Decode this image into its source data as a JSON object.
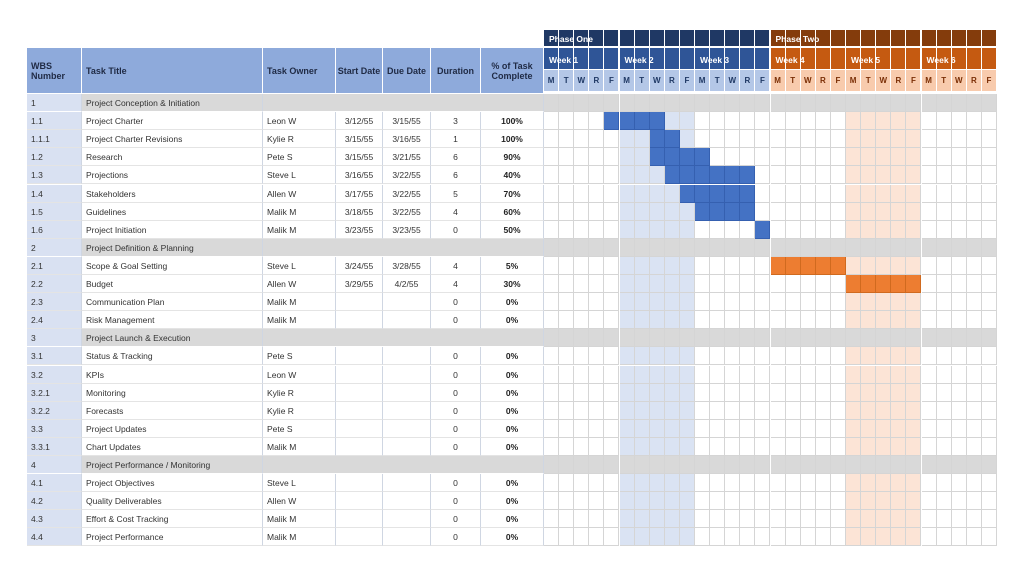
{
  "header": {
    "wbs": "WBS Number",
    "task_title": "Task Title",
    "task_owner": "Task Owner",
    "start_date": "Start Date",
    "due_date": "Due Date",
    "duration": "Duration",
    "pct_complete": "% of Task Complete"
  },
  "phases": [
    {
      "label": "Phase One",
      "weeks": 3
    },
    {
      "label": "Phase Two",
      "weeks": 3
    }
  ],
  "weeks": [
    "Week 1",
    "Week 2",
    "Week 3",
    "Week 4",
    "Week 5",
    "Week 6"
  ],
  "day_letters": [
    "M",
    "T",
    "W",
    "R",
    "F"
  ],
  "colors": {
    "phase_one_dark": "#1f3864",
    "phase_one_header": "#2f5597",
    "phase_one_day": "#b4c7e7",
    "phase_one_bar": "#4472c4",
    "phase_two_dark": "#843c0c",
    "phase_two_header": "#c55a11",
    "phase_two_day": "#f8cbad",
    "phase_two_bar": "#ed7d31",
    "highlight_blue": "#dae3f3",
    "highlight_orange": "#fce4d6"
  },
  "rows": [
    {
      "type": "section",
      "wbs": "1",
      "title": "Project Conception & Initiation"
    },
    {
      "type": "task",
      "wbs": "1.1",
      "title": "Project Charter",
      "owner": "Leon W",
      "start": "3/12/55",
      "due": "3/15/55",
      "duration": "3",
      "pct": "100%",
      "bar_start": 4,
      "bar_len": 4
    },
    {
      "type": "task",
      "wbs": "1.1.1",
      "title": "Project Charter Revisions",
      "owner": "Kylie R",
      "start": "3/15/55",
      "due": "3/16/55",
      "duration": "1",
      "pct": "100%",
      "bar_start": 7,
      "bar_len": 2
    },
    {
      "type": "task",
      "wbs": "1.2",
      "title": "Research",
      "owner": "Pete S",
      "start": "3/15/55",
      "due": "3/21/55",
      "duration": "6",
      "pct": "90%",
      "bar_start": 7,
      "bar_len": 4
    },
    {
      "type": "task",
      "wbs": "1.3",
      "title": "Projections",
      "owner": "Steve L",
      "start": "3/16/55",
      "due": "3/22/55",
      "duration": "6",
      "pct": "40%",
      "bar_start": 8,
      "bar_len": 6
    },
    {
      "type": "task",
      "wbs": "1.4",
      "title": "Stakeholders",
      "owner": "Allen W",
      "start": "3/17/55",
      "due": "3/22/55",
      "duration": "5",
      "pct": "70%",
      "bar_start": 9,
      "bar_len": 5
    },
    {
      "type": "task",
      "wbs": "1.5",
      "title": "Guidelines",
      "owner": "Malik M",
      "start": "3/18/55",
      "due": "3/22/55",
      "duration": "4",
      "pct": "60%",
      "bar_start": 10,
      "bar_len": 4
    },
    {
      "type": "task",
      "wbs": "1.6",
      "title": "Project Initiation",
      "owner": "Malik M",
      "start": "3/23/55",
      "due": "3/23/55",
      "duration": "0",
      "pct": "50%",
      "bar_start": 14,
      "bar_len": 1
    },
    {
      "type": "section",
      "wbs": "2",
      "title": "Project Definition & Planning"
    },
    {
      "type": "task",
      "wbs": "2.1",
      "title": "Scope & Goal Setting",
      "owner": "Steve L",
      "start": "3/24/55",
      "due": "3/28/55",
      "duration": "4",
      "pct": "5%",
      "bar_start": 15,
      "bar_len": 5
    },
    {
      "type": "task",
      "wbs": "2.2",
      "title": "Budget",
      "owner": "Allen W",
      "start": "3/29/55",
      "due": "4/2/55",
      "duration": "4",
      "pct": "30%",
      "bar_start": 20,
      "bar_len": 5
    },
    {
      "type": "task",
      "wbs": "2.3",
      "title": "Communication Plan",
      "owner": "Malik M",
      "start": "",
      "due": "",
      "duration": "0",
      "pct": "0%"
    },
    {
      "type": "task",
      "wbs": "2.4",
      "title": "Risk Management",
      "owner": "Malik M",
      "start": "",
      "due": "",
      "duration": "0",
      "pct": "0%"
    },
    {
      "type": "section",
      "wbs": "3",
      "title": "Project Launch & Execution"
    },
    {
      "type": "task",
      "wbs": "3.1",
      "title": "Status & Tracking",
      "owner": "Pete S",
      "start": "",
      "due": "",
      "duration": "0",
      "pct": "0%"
    },
    {
      "type": "task",
      "wbs": "3.2",
      "title": "KPIs",
      "owner": "Leon W",
      "start": "",
      "due": "",
      "duration": "0",
      "pct": "0%"
    },
    {
      "type": "task",
      "wbs": "3.2.1",
      "title": "Monitoring",
      "owner": "Kylie R",
      "start": "",
      "due": "",
      "duration": "0",
      "pct": "0%"
    },
    {
      "type": "task",
      "wbs": "3.2.2",
      "title": "Forecasts",
      "owner": "Kylie R",
      "start": "",
      "due": "",
      "duration": "0",
      "pct": "0%"
    },
    {
      "type": "task",
      "wbs": "3.3",
      "title": "Project Updates",
      "owner": "Pete S",
      "start": "",
      "due": "",
      "duration": "0",
      "pct": "0%"
    },
    {
      "type": "task",
      "wbs": "3.3.1",
      "title": "Chart Updates",
      "owner": "Malik M",
      "start": "",
      "due": "",
      "duration": "0",
      "pct": "0%"
    },
    {
      "type": "section",
      "wbs": "4",
      "title": "Project Performance / Monitoring"
    },
    {
      "type": "task",
      "wbs": "4.1",
      "title": "Project Objectives",
      "owner": "Steve L",
      "start": "",
      "due": "",
      "duration": "0",
      "pct": "0%"
    },
    {
      "type": "task",
      "wbs": "4.2",
      "title": "Quality Deliverables",
      "owner": "Allen W",
      "start": "",
      "due": "",
      "duration": "0",
      "pct": "0%"
    },
    {
      "type": "task",
      "wbs": "4.3",
      "title": "Effort & Cost Tracking",
      "owner": "Malik M",
      "start": "",
      "due": "",
      "duration": "0",
      "pct": "0%"
    },
    {
      "type": "task",
      "wbs": "4.4",
      "title": "Project Performance",
      "owner": "Malik M",
      "start": "",
      "due": "",
      "duration": "0",
      "pct": "0%"
    }
  ]
}
